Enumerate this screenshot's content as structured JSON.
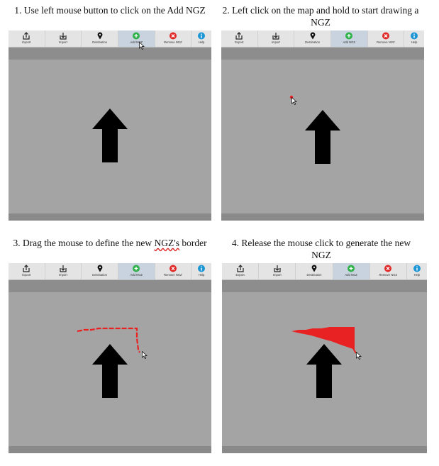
{
  "steps": [
    {
      "caption_before": "1. Use left mouse button to click on the Add NGZ",
      "caption_squiggle": "",
      "caption_after": ""
    },
    {
      "caption_before": "2. Left click on the map and hold to start drawing a NGZ",
      "caption_squiggle": "",
      "caption_after": ""
    },
    {
      "caption_before": "3. Drag the mouse to define the new ",
      "caption_squiggle": "NGZ's",
      "caption_after": " border"
    },
    {
      "caption_before": "4. Release the mouse click to generate the new NGZ",
      "caption_squiggle": "",
      "caption_after": ""
    }
  ],
  "toolbar": {
    "items": [
      {
        "label": "Export",
        "icon": "export-icon"
      },
      {
        "label": "Import",
        "icon": "import-icon"
      },
      {
        "label": "Destination",
        "icon": "map-pin-icon"
      },
      {
        "label": "Add NGZ",
        "icon": "add-circle-icon"
      },
      {
        "label": "Remove NGZ",
        "icon": "remove-circle-icon"
      },
      {
        "label": "Help",
        "icon": "info-icon"
      }
    ],
    "active_index": 3
  },
  "colors": {
    "map": "#a4a4a4",
    "toolbar": "#e4e4e4",
    "strip": "#8d8d8d",
    "ngz": "#e82222",
    "add": "#2fb24a",
    "remove": "#e02828",
    "help": "#1e95d4"
  }
}
